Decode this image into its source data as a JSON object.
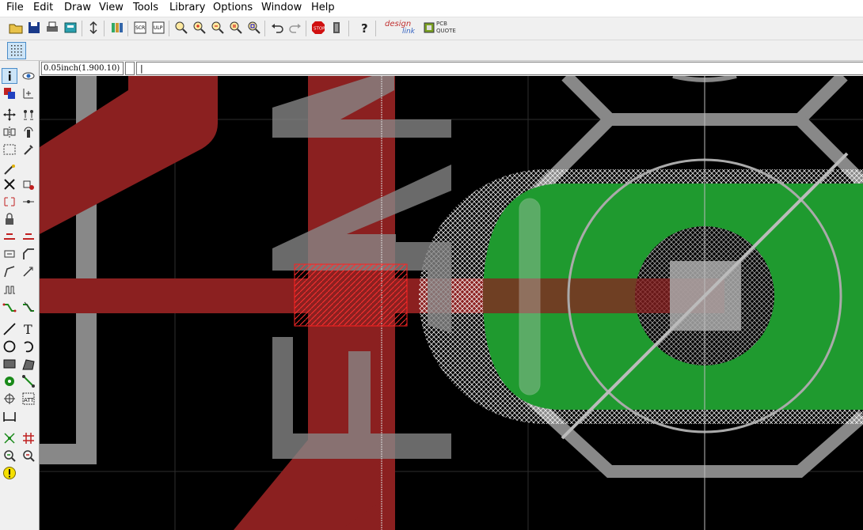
{
  "menu": [
    "File",
    "Edit",
    "Draw",
    "View",
    "Tools",
    "Library",
    "Options",
    "Window",
    "Help"
  ],
  "toolbar": {
    "icons": [
      "open-icon",
      "save-icon",
      "print-icon",
      "cam-processor-icon",
      "board-schematic-switch-icon",
      "library-icon",
      "script-icon",
      "ulp-icon",
      "zoom-fit-icon",
      "zoom-in-icon",
      "zoom-out-icon",
      "zoom-redraw-icon",
      "zoom-select-icon",
      "undo-icon",
      "redo-icon",
      "stop-icon",
      "go-icon",
      "help-icon"
    ],
    "designlink_top": "design",
    "designlink_bottom": "link",
    "pcb_quote_top": "PCB",
    "pcb_quote_bottom": "QUOTE"
  },
  "status": {
    "grid": "0.05inch(1.900.10)",
    "command": "|"
  },
  "left_tools": [
    "info",
    "show",
    "display-layers",
    "mark",
    "move",
    "copy",
    "mirror",
    "rotate",
    "group",
    "change",
    "paste",
    "delete",
    "add",
    "smash",
    "split",
    "miter",
    "optimize",
    "route",
    "ripup",
    "wire",
    "text",
    "circle",
    "arc",
    "rectangle",
    "polygon",
    "via",
    "signal",
    "hole",
    "attribute",
    "dimension",
    "ratsnest",
    "auto",
    "drc",
    "errors"
  ],
  "colors": {
    "canvas": "#000000",
    "top_copper": "#8b2020",
    "silkscreen": "#888888",
    "pad_fill": "#1f9a2f",
    "highlight": "#ff0000"
  }
}
